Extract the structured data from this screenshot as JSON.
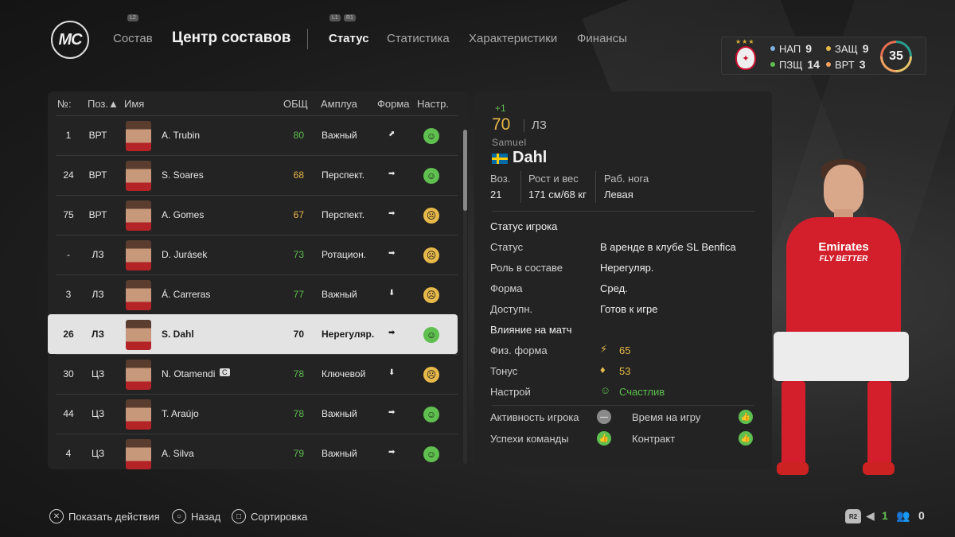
{
  "nav": {
    "l2": "L2",
    "l1": "L1",
    "r1": "R1",
    "sostav": "Состав",
    "center": "Центр составов",
    "tabs": [
      "Статус",
      "Статистика",
      "Характеристики",
      "Финансы"
    ]
  },
  "club": {
    "stars": "★★★",
    "stats": [
      {
        "label": "НАП",
        "value": "9",
        "color": "#7db2e0"
      },
      {
        "label": "ЗАЩ",
        "value": "9",
        "color": "#e7b94a"
      },
      {
        "label": "ПЗЩ",
        "value": "14",
        "color": "#5fbf4f"
      },
      {
        "label": "ВРТ",
        "value": "3",
        "color": "#f4a261"
      }
    ],
    "total": "35"
  },
  "table": {
    "headers": {
      "num": "№:",
      "pos": "Поз.▲",
      "name": "Имя",
      "ovr": "ОБЩ",
      "role": "Амплуа",
      "form": "Форма",
      "mood": "Настр."
    },
    "rows": [
      {
        "num": "1",
        "pos": "ВРТ",
        "name": "A. Trubin",
        "ovr": "80",
        "ovr_color": "green",
        "role": "Важный",
        "arrow": "⬈",
        "mood": "happy"
      },
      {
        "num": "24",
        "pos": "ВРТ",
        "name": "S. Soares",
        "ovr": "68",
        "ovr_color": "yellow",
        "role": "Перспект.",
        "arrow": "➡",
        "mood": "happy"
      },
      {
        "num": "75",
        "pos": "ВРТ",
        "name": "A. Gomes",
        "ovr": "67",
        "ovr_color": "yellow",
        "role": "Перспект.",
        "arrow": "➡",
        "mood": "neutral"
      },
      {
        "num": "-",
        "pos": "ЛЗ",
        "name": "D. Jurásek",
        "ovr": "73",
        "ovr_color": "green",
        "role": "Ротацион.",
        "arrow": "➡",
        "mood": "neutral"
      },
      {
        "num": "3",
        "pos": "ЛЗ",
        "name": "Á. Carreras",
        "ovr": "77",
        "ovr_color": "green",
        "role": "Важный",
        "arrow": "⬇",
        "mood": "neutral"
      },
      {
        "num": "26",
        "pos": "ЛЗ",
        "name": "S. Dahl",
        "ovr": "70",
        "ovr_color": "white",
        "role": "Нерегуляр.",
        "arrow": "➡",
        "mood": "happy",
        "selected": true
      },
      {
        "num": "30",
        "pos": "ЦЗ",
        "name": "N. Otamendi",
        "ovr": "78",
        "ovr_color": "green",
        "role": "Ключевой",
        "arrow": "⬇",
        "mood": "neutral",
        "badge": "C"
      },
      {
        "num": "44",
        "pos": "ЦЗ",
        "name": "T. Araújo",
        "ovr": "78",
        "ovr_color": "green",
        "role": "Важный",
        "arrow": "➡",
        "mood": "happy"
      },
      {
        "num": "4",
        "pos": "ЦЗ",
        "name": "A. Silva",
        "ovr": "79",
        "ovr_color": "green",
        "role": "Важный",
        "arrow": "➡",
        "mood": "happy"
      }
    ]
  },
  "player": {
    "plus": "+1",
    "ovr": "70",
    "pos": "ЛЗ",
    "first_name": "Samuel",
    "last_name": "Dahl",
    "age_label": "Воз.",
    "age": "21",
    "hw_label": "Рост и вес",
    "hw": "171 см/68 кг",
    "foot_label": "Раб. нога",
    "foot": "Левая",
    "status_section": "Статус игрока",
    "status_label": "Статус",
    "status": "В аренде в клубе SL Benfica",
    "squad_role_label": "Роль в составе",
    "squad_role": "Нерегуляр.",
    "form_label": "Форма",
    "form": "Сред.",
    "avail_label": "Доступн.",
    "avail": "Готов к игре",
    "impact_section": "Влияние на матч",
    "fitness_label": "Физ. форма",
    "fitness": "65",
    "sharpness_label": "Тонус",
    "sharpness": "53",
    "morale_label": "Настрой",
    "morale": "Счастлив",
    "activity_label": "Активность игрока",
    "playtime_label": "Время на игру",
    "team_success_label": "Успехи команды",
    "contract_label": "Контракт",
    "sponsor": "Emirates",
    "sponsor_sub": "FLY BETTER"
  },
  "bottom": {
    "show_actions": "Показать действия",
    "back": "Назад",
    "sort": "Сортировка",
    "r2": "R2",
    "count1": "1",
    "count2": "0"
  }
}
